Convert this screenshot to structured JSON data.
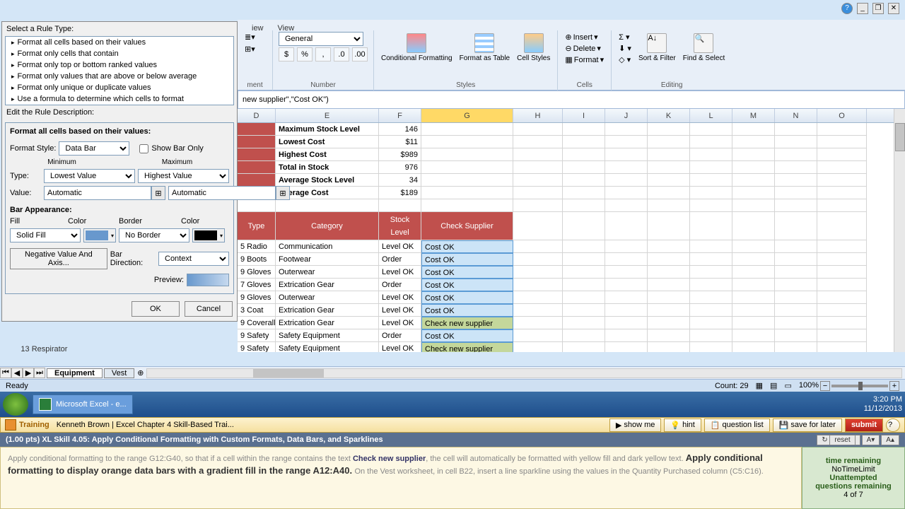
{
  "window": {
    "menu_iew": "iew",
    "menu_view": "View"
  },
  "dialog": {
    "select_rule": "Select a Rule Type:",
    "rules": [
      "Format all cells based on their values",
      "Format only cells that contain",
      "Format only top or bottom ranked values",
      "Format only values that are above or below average",
      "Format only unique or duplicate values",
      "Use a formula to determine which cells to format"
    ],
    "edit_desc": "Edit the Rule Description:",
    "format_all": "Format all cells based on their values:",
    "format_style": "Format Style:",
    "format_style_val": "Data Bar",
    "show_bar": "Show Bar Only",
    "minimum": "Minimum",
    "maximum": "Maximum",
    "type": "Type:",
    "type_min": "Lowest Value",
    "type_max": "Highest Value",
    "value": "Value:",
    "auto": "Automatic",
    "bar_app": "Bar Appearance:",
    "fill": "Fill",
    "color": "Color",
    "border": "Border",
    "fill_val": "Solid Fill",
    "border_val": "No Border",
    "neg": "Negative Value And Axis...",
    "bar_dir": "Bar Direction:",
    "bar_dir_val": "Context",
    "preview": "Preview:",
    "ok": "OK",
    "cancel": "Cancel",
    "color1": "#6898cd",
    "color2": "#000000"
  },
  "ribbon": {
    "number_label": "Number",
    "styles_label": "Styles",
    "cells_label": "Cells",
    "editing_label": "Editing",
    "general": "General",
    "cond": "Conditional\nFormatting",
    "fmt_table": "Format as\nTable",
    "cell_st": "Cell\nStyles",
    "insert": "Insert",
    "delete": "Delete",
    "format": "Format",
    "sort": "Sort &\nFilter",
    "find": "Find &\nSelect"
  },
  "formula": "new supplier\",\"Cost OK\")",
  "cols": [
    "D",
    "E",
    "F",
    "G",
    "H",
    "I",
    "J",
    "K",
    "L",
    "M",
    "N",
    "O"
  ],
  "summary": [
    {
      "label": "Maximum Stock Level",
      "val": "146"
    },
    {
      "label": "Lowest Cost",
      "val": "$11"
    },
    {
      "label": "Highest Cost",
      "val": "$989"
    },
    {
      "label": "Total in Stock",
      "val": "976"
    },
    {
      "label": "Average Stock Level",
      "val": "34"
    },
    {
      "label": "Average Cost",
      "val": "$189"
    }
  ],
  "thead": {
    "type": "Type",
    "cat": "Category",
    "stock": "Stock\nLevel",
    "check": "Check Supplier"
  },
  "rows": [
    {
      "n": "5",
      "type": "Radio",
      "cat": "Communication",
      "stock": "Level OK",
      "check": "Cost OK",
      "hl": false
    },
    {
      "n": "9",
      "type": "Boots",
      "cat": "Footwear",
      "stock": "Order",
      "check": "Cost OK",
      "hl": false
    },
    {
      "n": "9",
      "type": "Gloves",
      "cat": "Outerwear",
      "stock": "Level OK",
      "check": "Cost OK",
      "hl": false
    },
    {
      "n": "7",
      "type": "Gloves",
      "cat": "Extrication Gear",
      "stock": "Order",
      "check": "Cost OK",
      "hl": false
    },
    {
      "n": "9",
      "type": "Gloves",
      "cat": "Outerwear",
      "stock": "Level OK",
      "check": "Cost OK",
      "hl": false
    },
    {
      "n": "3",
      "type": "Coat",
      "cat": "Extrication Gear",
      "stock": "Level OK",
      "check": "Cost OK",
      "hl": false
    },
    {
      "n": "9",
      "type": "Coveralls",
      "cat": "Extrication Gear",
      "stock": "Level OK",
      "check": "Check new supplier",
      "hl": true
    },
    {
      "n": "9",
      "type": "Safety",
      "cat": "Safety Equipment",
      "stock": "Order",
      "check": "Cost OK",
      "hl": false
    },
    {
      "n": "9",
      "type": "Safety",
      "cat": "Safety Equipment",
      "stock": "Level OK",
      "check": "Check new supplier",
      "hl": true
    }
  ],
  "under": {
    "num": "13",
    "txt": "Respirator"
  },
  "sheets": {
    "active": "Equipment",
    "other": "Vest"
  },
  "status": {
    "ready": "Ready",
    "count": "Count: 29",
    "zoom": "100%"
  },
  "task": {
    "app": "Microsoft Excel - e...",
    "time": "3:20 PM",
    "date": "11/12/2013"
  },
  "train": {
    "label": "Training",
    "user": "Kenneth Brown | Excel Chapter 4 Skill-Based Trai...",
    "show": "show me",
    "hint": "hint",
    "qlist": "question list",
    "save": "save for later",
    "submit": "submit",
    "qtitle": "(1.00 pts) XL Skill 4.05: Apply Conditional Formatting with Custom Formats, Data Bars, and Sparklines",
    "reset": "reset",
    "body1": "Apply conditional formatting to the range G12:G40, so that if a cell within the range contains the text ",
    "kw": "Check new supplier",
    "body2": ", the cell will automatically be formatted with yellow fill and dark yellow text. ",
    "bold": "Apply conditional formatting to display orange data bars with a gradient fill in the range A12:A40.",
    "body3": " On the Vest worksheet, in cell B22, insert a line sparkline using the values in the Quantity Purchased column (C5:C16).",
    "time_rem": "time remaining",
    "no_limit": "NoTimeLimit",
    "unatt": "Unattempted",
    "qrem": "questions remaining",
    "qnum": "4 of 7"
  }
}
